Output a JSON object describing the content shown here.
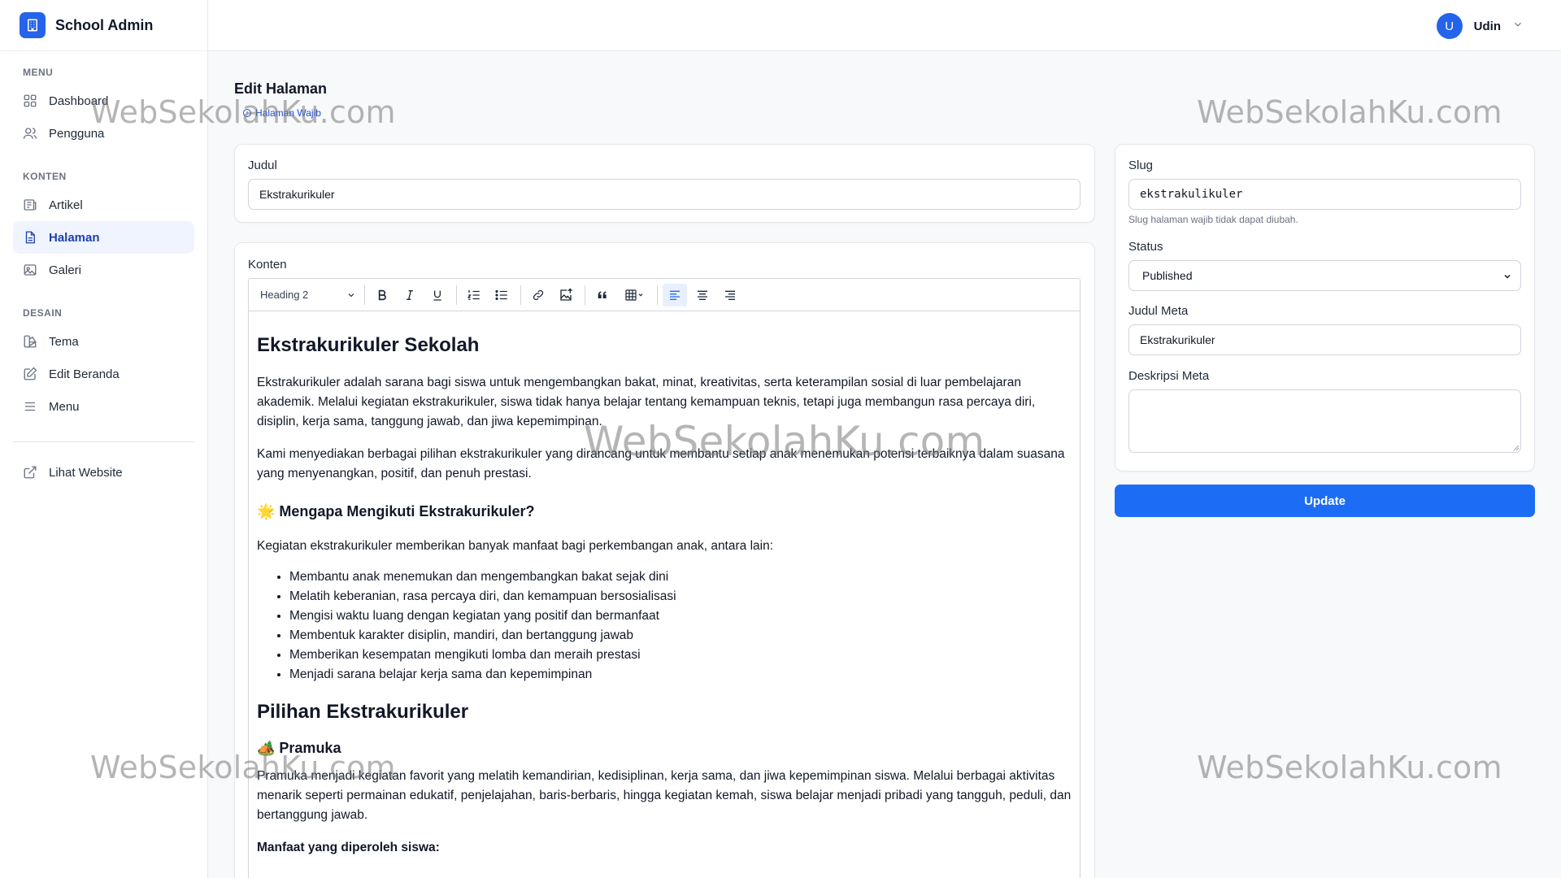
{
  "brand": {
    "title": "School Admin"
  },
  "sidebar": {
    "sections": [
      {
        "title": "MENU"
      },
      {
        "title": "KONTEN"
      },
      {
        "title": "DESAIN"
      }
    ],
    "items": [
      {
        "label": "Dashboard",
        "icon": "grid-icon"
      },
      {
        "label": "Pengguna",
        "icon": "users-icon"
      },
      {
        "label": "Artikel",
        "icon": "newspaper-icon"
      },
      {
        "label": "Halaman",
        "icon": "document-icon",
        "active": true
      },
      {
        "label": "Galeri",
        "icon": "image-icon"
      },
      {
        "label": "Tema",
        "icon": "palette-icon"
      },
      {
        "label": "Edit Beranda",
        "icon": "edit-icon"
      },
      {
        "label": "Menu",
        "icon": "bars-icon"
      },
      {
        "label": "Lihat Website",
        "icon": "external-link-icon"
      }
    ]
  },
  "topbar": {
    "avatar_initial": "U",
    "user_name": "Udin"
  },
  "page": {
    "title": "Edit Halaman",
    "badge": "Halaman Wajib"
  },
  "form": {
    "judul_label": "Judul",
    "judul_value": "Ekstrakurikuler",
    "konten_label": "Konten",
    "slug_label": "Slug",
    "slug_value": "ekstrakulikuler",
    "slug_hint": "Slug halaman wajib tidak dapat diubah.",
    "status_label": "Status",
    "status_value": "Published",
    "meta_title_label": "Judul Meta",
    "meta_title_value": "Ekstrakurikuler",
    "meta_desc_label": "Deskripsi Meta",
    "meta_desc_value": "",
    "update_label": "Update"
  },
  "editor": {
    "heading_select": "Heading 2",
    "content": {
      "h1": "Ekstrakurikuler Sekolah",
      "p1": "Ekstrakurikuler adalah sarana bagi siswa untuk mengembangkan bakat, minat, kreativitas, serta keterampilan sosial di luar pembelajaran akademik. Melalui kegiatan ekstrakurikuler, siswa tidak hanya belajar tentang kemampuan teknis, tetapi juga membangun rasa percaya diri, disiplin, kerja sama, tanggung jawab, dan jiwa kepemimpinan.",
      "p2": "Kami menyediakan berbagai pilihan ekstrakurikuler yang dirancang untuk membantu setiap anak menemukan potensi terbaiknya dalam suasana yang menyenangkan, positif, dan penuh prestasi.",
      "h2": "🌟 Mengapa Mengikuti Ekstrakurikuler?",
      "p3": "Kegiatan ekstrakurikuler memberikan banyak manfaat bagi perkembangan anak, antara lain:",
      "benefits": [
        "Membantu anak menemukan dan mengembangkan bakat sejak dini",
        "Melatih keberanian, rasa percaya diri, dan kemampuan bersosialisasi",
        "Mengisi waktu luang dengan kegiatan yang positif dan bermanfaat",
        "Membentuk karakter disiplin, mandiri, dan bertanggung jawab",
        "Memberikan kesempatan mengikuti lomba dan meraih prestasi",
        "Menjadi sarana belajar kerja sama dan kepemimpinan"
      ],
      "h3": "Pilihan Ekstrakurikuler",
      "h4": "🏕️ Pramuka",
      "p4": "Pramuka menjadi kegiatan favorit yang melatih kemandirian, kedisiplinan, kerja sama, dan jiwa kepemimpinan siswa. Melalui berbagai aktivitas menarik seperti permainan edukatif, penjelajahan, baris-berbaris, hingga kegiatan kemah, siswa belajar menjadi pribadi yang tangguh, peduli, dan bertanggung jawab.",
      "p5": "Manfaat yang diperoleh siswa:"
    }
  },
  "watermark": "WebSekolahKu.com",
  "colors": {
    "accent": "#2563eb",
    "active_bg": "#eff4fe",
    "update_btn": "#1d6cf5"
  }
}
